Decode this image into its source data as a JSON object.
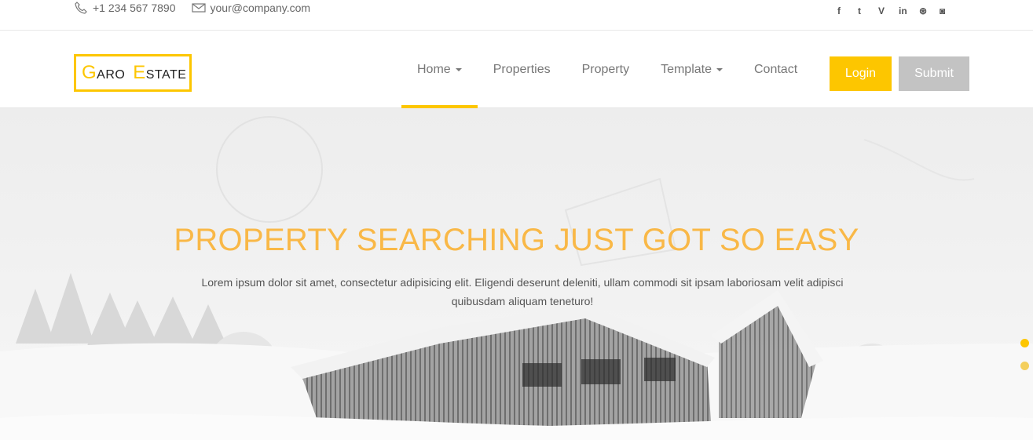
{
  "topbar": {
    "phone": "+1 234 567 7890",
    "email": "your@company.com",
    "social": [
      {
        "name": "facebook-icon",
        "glyph": "f"
      },
      {
        "name": "twitter-icon",
        "glyph": "t"
      },
      {
        "name": "vine-icon",
        "glyph": "V"
      },
      {
        "name": "linkedin-icon",
        "glyph": "in"
      },
      {
        "name": "dribbble-icon",
        "glyph": "⊛"
      },
      {
        "name": "instagram-icon",
        "glyph": "◙"
      }
    ]
  },
  "logo": {
    "g": "G",
    "aro": "ARO",
    "e": "E",
    "state": "STATE"
  },
  "nav": {
    "items": [
      {
        "label": "Home"
      },
      {
        "label": "Properties"
      },
      {
        "label": "Property"
      },
      {
        "label": "Template"
      },
      {
        "label": "Contact"
      }
    ],
    "login": "Login",
    "submit": "Submit"
  },
  "hero": {
    "title": "PROPERTY SEARCHING JUST GOT SO EASY",
    "text": "Lorem ipsum dolor sit amet, consectetur adipisicing elit. Eligendi deserunt deleniti, ullam commodi sit ipsam laboriosam velit adipisci quibusdam aliquam teneturo!"
  },
  "colors": {
    "accent": "#fdc600",
    "title": "#f9b847",
    "submit": "#c3c3c3"
  }
}
